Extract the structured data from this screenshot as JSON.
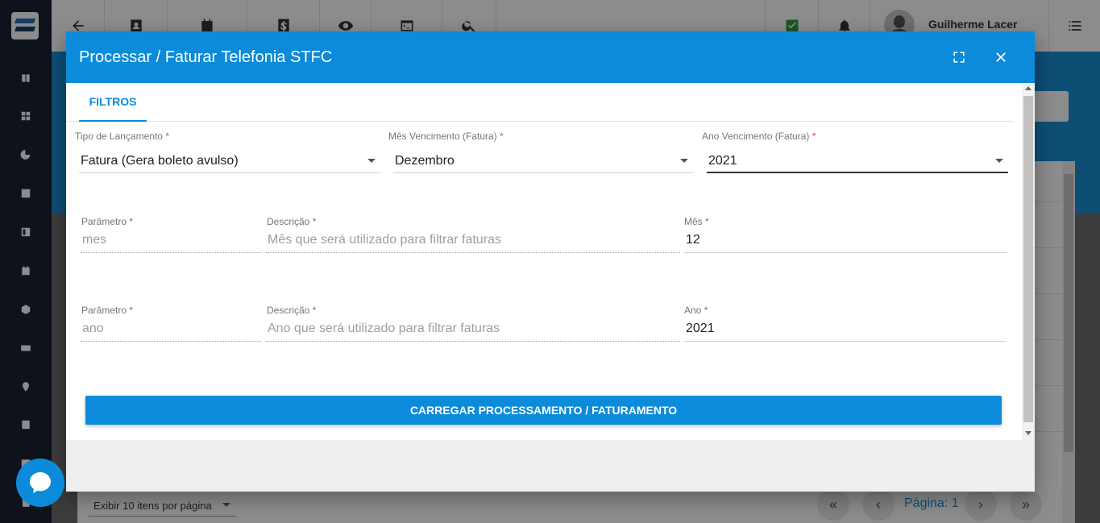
{
  "app": {
    "user_name": "Guilherme Lacer",
    "pager": {
      "items_per_page_label": "Exibir 10 itens por página",
      "page_label": "Página: 1"
    }
  },
  "modal": {
    "title": "Processar / Faturar Telefonia STFC",
    "tabs": [
      {
        "label": "FILTROS",
        "active": true
      }
    ],
    "filters": {
      "tipo_lancamento": {
        "label": "Tipo de Lançamento",
        "required_mark": "*",
        "value": "Fatura (Gera boleto avulso)"
      },
      "mes_vencimento": {
        "label": "Mês Vencimento (Fatura)",
        "required_mark": "*",
        "value": "Dezembro"
      },
      "ano_vencimento": {
        "label": "Ano Vencimento (Fatura)",
        "required_mark": "*",
        "value": "2021"
      }
    },
    "params": [
      {
        "parametro_label": "Parâmetro",
        "parametro_value": "mes",
        "descricao_label": "Descrição",
        "descricao_value": "Mês que será utilizado para filtrar faturas",
        "valor_label": "Mês",
        "valor_value": "12",
        "required_mark": "*"
      },
      {
        "parametro_label": "Parâmetro",
        "parametro_value": "ano",
        "descricao_label": "Descrição",
        "descricao_value": "Ano que será utilizado para filtrar faturas",
        "valor_label": "Ano",
        "valor_value": "2021",
        "required_mark": "*"
      }
    ],
    "action_button": "CARREGAR PROCESSAMENTO / FATURAMENTO"
  },
  "colors": {
    "primary": "#0b8bd9",
    "required_accent": "#e53935",
    "sidebar": "#1b2230"
  },
  "icons": {
    "header": [
      "fullscreen-icon",
      "close-icon"
    ],
    "topbar": [
      "back-arrow-icon",
      "contact-card-icon",
      "calendar-clock-icon",
      "dollar-icon",
      "eye-icon",
      "terminal-icon",
      "search-icon",
      "check-icon",
      "bell-icon",
      "menu-list-icon"
    ],
    "sidebar": [
      "book-icon",
      "dashboard-icon",
      "pie-chart-icon",
      "contact-icon",
      "board-icon",
      "calendar-icon",
      "box-icon",
      "money-icon",
      "location-icon",
      "document-icon",
      "table-icon",
      "file-icon"
    ],
    "chat": "chat-icon"
  }
}
